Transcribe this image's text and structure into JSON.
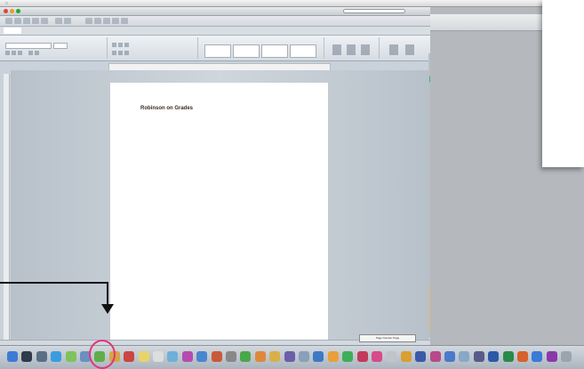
{
  "document": {
    "heading": "Robinson on Grades",
    "status_popup": "Page Number Page"
  },
  "colors": {
    "highlight_ring": "#e0367a",
    "scroll_knob": "#39b36a",
    "arrow": "#111111"
  },
  "dock": {
    "icons": [
      {
        "name": "finder-icon",
        "color": "#3d7bd6"
      },
      {
        "name": "dashboard-icon",
        "color": "#2f3a4a"
      },
      {
        "name": "mission-control-icon",
        "color": "#5a6e86"
      },
      {
        "name": "safari-icon",
        "color": "#3a9ce0"
      },
      {
        "name": "messages-icon",
        "color": "#7fc35a"
      },
      {
        "name": "mail-icon",
        "color": "#6b8fbf"
      },
      {
        "name": "highlighted-app-icon",
        "color": "#5fae4a"
      },
      {
        "name": "photos-icon",
        "color": "#d9a441"
      },
      {
        "name": "calendar-icon",
        "color": "#c44"
      },
      {
        "name": "notes-icon",
        "color": "#e8d36a"
      },
      {
        "name": "reminders-icon",
        "color": "#ddd"
      },
      {
        "name": "maps-icon",
        "color": "#6fb0d8"
      },
      {
        "name": "itunes-icon",
        "color": "#b54bb0"
      },
      {
        "name": "app-store-icon",
        "color": "#4a86d0"
      },
      {
        "name": "preview-icon",
        "color": "#c85a3a"
      },
      {
        "name": "system-preferences-icon",
        "color": "#888"
      },
      {
        "name": "facetime-icon",
        "color": "#49a84a"
      },
      {
        "name": "ibooks-icon",
        "color": "#e0883a"
      },
      {
        "name": "garageband-icon",
        "color": "#d8b04a"
      },
      {
        "name": "imovie-icon",
        "color": "#6a5fa8"
      },
      {
        "name": "iphoto-icon",
        "color": "#8aa0b8"
      },
      {
        "name": "keynote-icon",
        "color": "#3f79c4"
      },
      {
        "name": "pages-icon",
        "color": "#e8a03a"
      },
      {
        "name": "numbers-icon",
        "color": "#3fae5a"
      },
      {
        "name": "photo-booth-icon",
        "color": "#c43a5a"
      },
      {
        "name": "folder-icon",
        "color": "#d84a8a"
      },
      {
        "name": "document-icon",
        "color": "#c0c4c8"
      },
      {
        "name": "archive-icon",
        "color": "#d8a030"
      },
      {
        "name": "stack-1-icon",
        "color": "#3a5aa8"
      },
      {
        "name": "stack-2-icon",
        "color": "#b84a8a"
      },
      {
        "name": "stack-3-icon",
        "color": "#4a7ac8"
      },
      {
        "name": "stack-4-icon",
        "color": "#88a8c8"
      },
      {
        "name": "stack-5-icon",
        "color": "#5a5a8a"
      },
      {
        "name": "word-icon",
        "color": "#2a5aa8"
      },
      {
        "name": "excel-icon",
        "color": "#2a8a4a"
      },
      {
        "name": "powerpoint-icon",
        "color": "#d8602a"
      },
      {
        "name": "outlook-icon",
        "color": "#3a7ad8"
      },
      {
        "name": "onenote-icon",
        "color": "#8a3aa8"
      },
      {
        "name": "trash-icon",
        "color": "#9aa4ae"
      }
    ]
  }
}
